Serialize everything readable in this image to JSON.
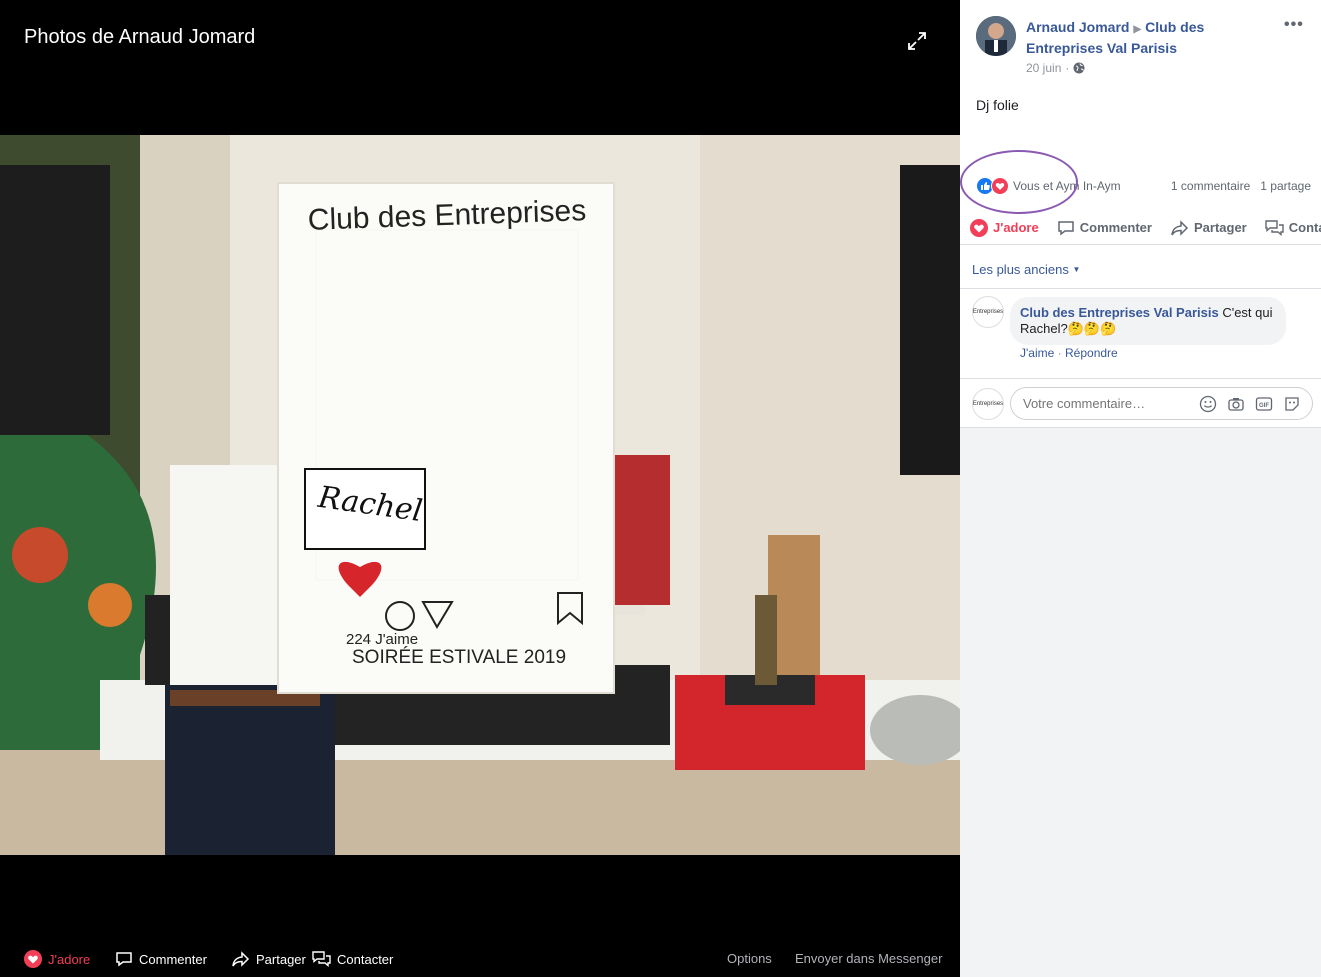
{
  "viewer": {
    "title": "Photos de Arnaud Jomard",
    "photo_sign_text": "Club des Entreprises",
    "photo_rachel": "Rachel",
    "photo_likes": "224 J'aime",
    "photo_event": "SOIRÉE ESTIVALE 2019",
    "bottom": {
      "love_label": "J'adore",
      "comment_label": "Commenter",
      "share_label": "Partager",
      "contact_label": "Contacter",
      "options_label": "Options",
      "messenger_label": "Envoyer dans Messenger"
    }
  },
  "post": {
    "author": "Arnaud Jomard",
    "target": "Club des Entreprises Val Parisis",
    "date": "20 juin",
    "separator": "·",
    "text": "Dj folie",
    "reactions_text": "Vous et Aym In-Aym",
    "comments_count": "1 commentaire",
    "shares_count": "1 partage",
    "actions": {
      "love": "J'adore",
      "comment": "Commenter",
      "share": "Partager",
      "contact": "Contacter"
    },
    "sort_label": "Les plus anciens",
    "comment": {
      "author": "Club des Entreprises Val Parisis",
      "text": "C'est qui Rachel?🤔🤔🤔",
      "like_link": "J'aime",
      "dot": "·",
      "reply_link": "Répondre",
      "avatar_text": "Entreprises"
    },
    "composer_placeholder": "Votre commentaire…",
    "composer_avatar_text": "Entreprises"
  },
  "colors": {
    "link": "#385898",
    "love": "#f33e58",
    "like": "#1877f2",
    "highlight": "#8a5ab3"
  }
}
